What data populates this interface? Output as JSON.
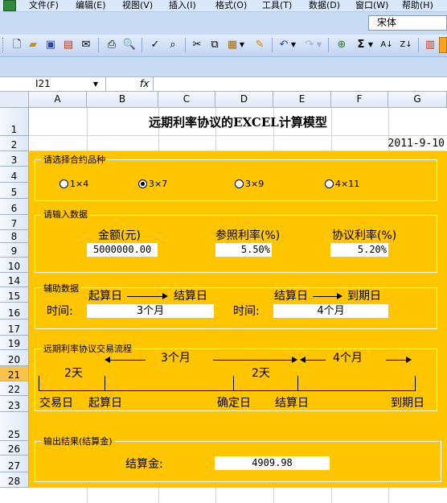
{
  "menu": {
    "file": "文件(F)",
    "edit": "编辑(E)",
    "view": "视图(V)",
    "insert": "插入(I)",
    "format": "格式(O)",
    "tools": "工具(T)",
    "data": "数据(D)",
    "window": "窗口(W)",
    "help": "帮助(H)"
  },
  "font_box": {
    "value": "宋体"
  },
  "formula_bar": {
    "name_box": "I21",
    "fx": "fx",
    "formula": ""
  },
  "columns": [
    "A",
    "B",
    "C",
    "D",
    "E",
    "F",
    "G"
  ],
  "rows": [
    "1",
    "2",
    "3",
    "4",
    "5",
    "6",
    "7",
    "8",
    "9",
    "10",
    "14",
    "15",
    "16",
    "17",
    "19",
    "20",
    "21",
    "22",
    "23",
    "25",
    "26",
    "27",
    "28"
  ],
  "selected_row": "21",
  "sheet": {
    "title": "远期利率协议的EXCEL计算模型",
    "date": "2011-9-10",
    "contract": {
      "title": "请选择合约品种",
      "options": [
        "1×4",
        "3×7",
        "3×9",
        "4×11"
      ],
      "selected_index": 1
    },
    "input": {
      "title": "请输入数据",
      "amount_label": "金额(元)",
      "amount_value": "5000000.00",
      "ref_rate_label": "参照利率(%)",
      "ref_rate_value": "5.50%",
      "agreed_rate_label": "协议利率(%)",
      "agreed_rate_value": "5.20%"
    },
    "aux": {
      "title": "辅助数据",
      "start_label": "起算日",
      "settle_label": "结算日",
      "settle_label2": "结算日",
      "maturity_label": "到期日",
      "time_label1": "时间:",
      "time_value1": "3个月",
      "time_label2": "时间:",
      "time_value2": "4个月"
    },
    "flow": {
      "title": "远期利率协议交易流程",
      "period1": "3个月",
      "period2": "4个月",
      "days1": "2天",
      "days2": "2天",
      "trade_day": "交易日",
      "start_day": "起算日",
      "fixing_day": "确定日",
      "settle_day": "结算日",
      "maturity_day": "到期日"
    },
    "output": {
      "title": "输出结果(结算金)",
      "label": "结算金:",
      "value": "4909.98"
    }
  },
  "colors": {
    "panel_fill": "#ffc600",
    "selected_row_header": "#f8c34b",
    "ui_blue": "#c9daf3"
  }
}
